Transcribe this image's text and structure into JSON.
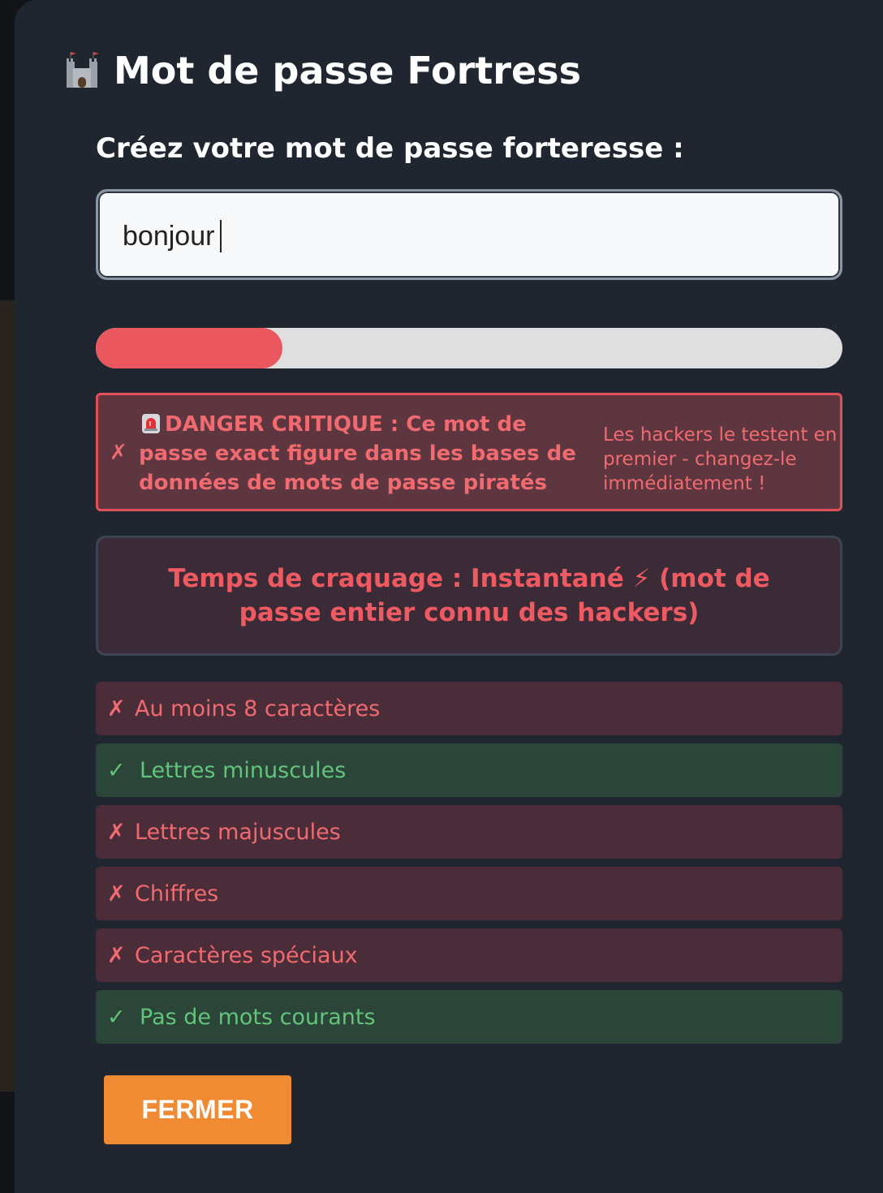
{
  "modal": {
    "title": "Mot de passe Fortress",
    "title_icon": "castle-icon"
  },
  "form": {
    "label": "Créez votre mot de passe forteresse :",
    "password_value": "bonjour"
  },
  "strength": {
    "level_fraction": 0.25,
    "color": "#eb575e"
  },
  "danger": {
    "icon": "siren-icon",
    "mark": "✗",
    "main_text": "DANGER CRITIQUE : Ce mot de passe exact figure dans les bases de données de mots de passe piratés",
    "sub_text": "Les hackers le testent en premier - changez-le immédiatement !"
  },
  "crack_time": {
    "text": "Temps de craquage : Instantané ⚡ (mot de passe entier connu des hackers)"
  },
  "criteria": [
    {
      "mark": "✗",
      "label": "Au moins 8 caractères",
      "status": "fail"
    },
    {
      "mark": "✓",
      "label": "Lettres minuscules",
      "status": "pass"
    },
    {
      "mark": "✗",
      "label": "Lettres majuscules",
      "status": "fail"
    },
    {
      "mark": "✗",
      "label": "Chiffres",
      "status": "fail"
    },
    {
      "mark": "✗",
      "label": "Caractères spéciaux",
      "status": "fail"
    },
    {
      "mark": "✓",
      "label": "Pas de mots courants",
      "status": "pass"
    }
  ],
  "colors": {
    "fail": "#f06a70",
    "pass": "#62c47a",
    "accent": "#f08b33"
  },
  "actions": {
    "close_label": "FERMER"
  }
}
